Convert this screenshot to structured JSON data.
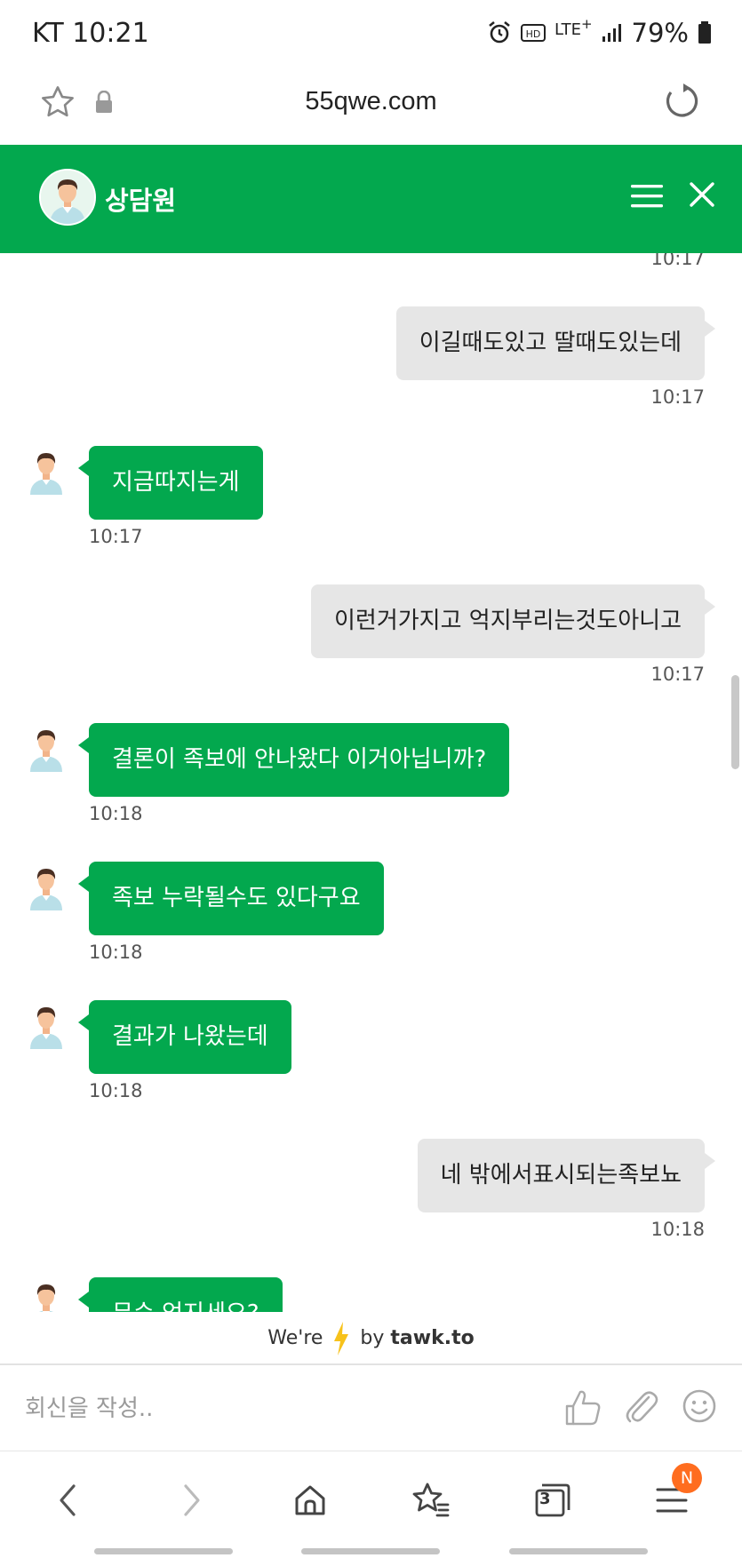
{
  "status_bar": {
    "carrier_time": "KT 10:21",
    "network": "LTE",
    "network_plus": "+",
    "battery": "79%"
  },
  "browser": {
    "url": "55qwe.com"
  },
  "chat": {
    "agent_name": "상담원",
    "accent_color": "#03a84e",
    "top_time": "10:17",
    "messages": [
      {
        "side": "out",
        "text": "이길때도있고 딸때도있는데",
        "time": "10:17"
      },
      {
        "side": "in",
        "text": "지금따지는게",
        "time": "10:17"
      },
      {
        "side": "out",
        "text": "이런거가지고 억지부리는것도아니고",
        "time": "10:17"
      },
      {
        "side": "in",
        "text": "결론이 족보에 안나왔다 이거아닙니까?",
        "time": "10:18"
      },
      {
        "side": "in",
        "text": "족보 누락될수도 있다구요",
        "time": "10:18"
      },
      {
        "side": "in",
        "text": "결과가 나왔는데",
        "time": "10:18"
      },
      {
        "side": "out",
        "text": "네 밖에서표시되는족보뇨",
        "time": "10:18"
      },
      {
        "side": "in",
        "text": "무슨 억지세요?",
        "time": ""
      }
    ]
  },
  "footer": {
    "powered_prefix": "We're",
    "powered_by": "by",
    "brand": "tawk.to"
  },
  "input": {
    "placeholder": "회신을 작성.."
  },
  "bottom_nav": {
    "tabs_count": "3",
    "menu_badge": "N"
  }
}
